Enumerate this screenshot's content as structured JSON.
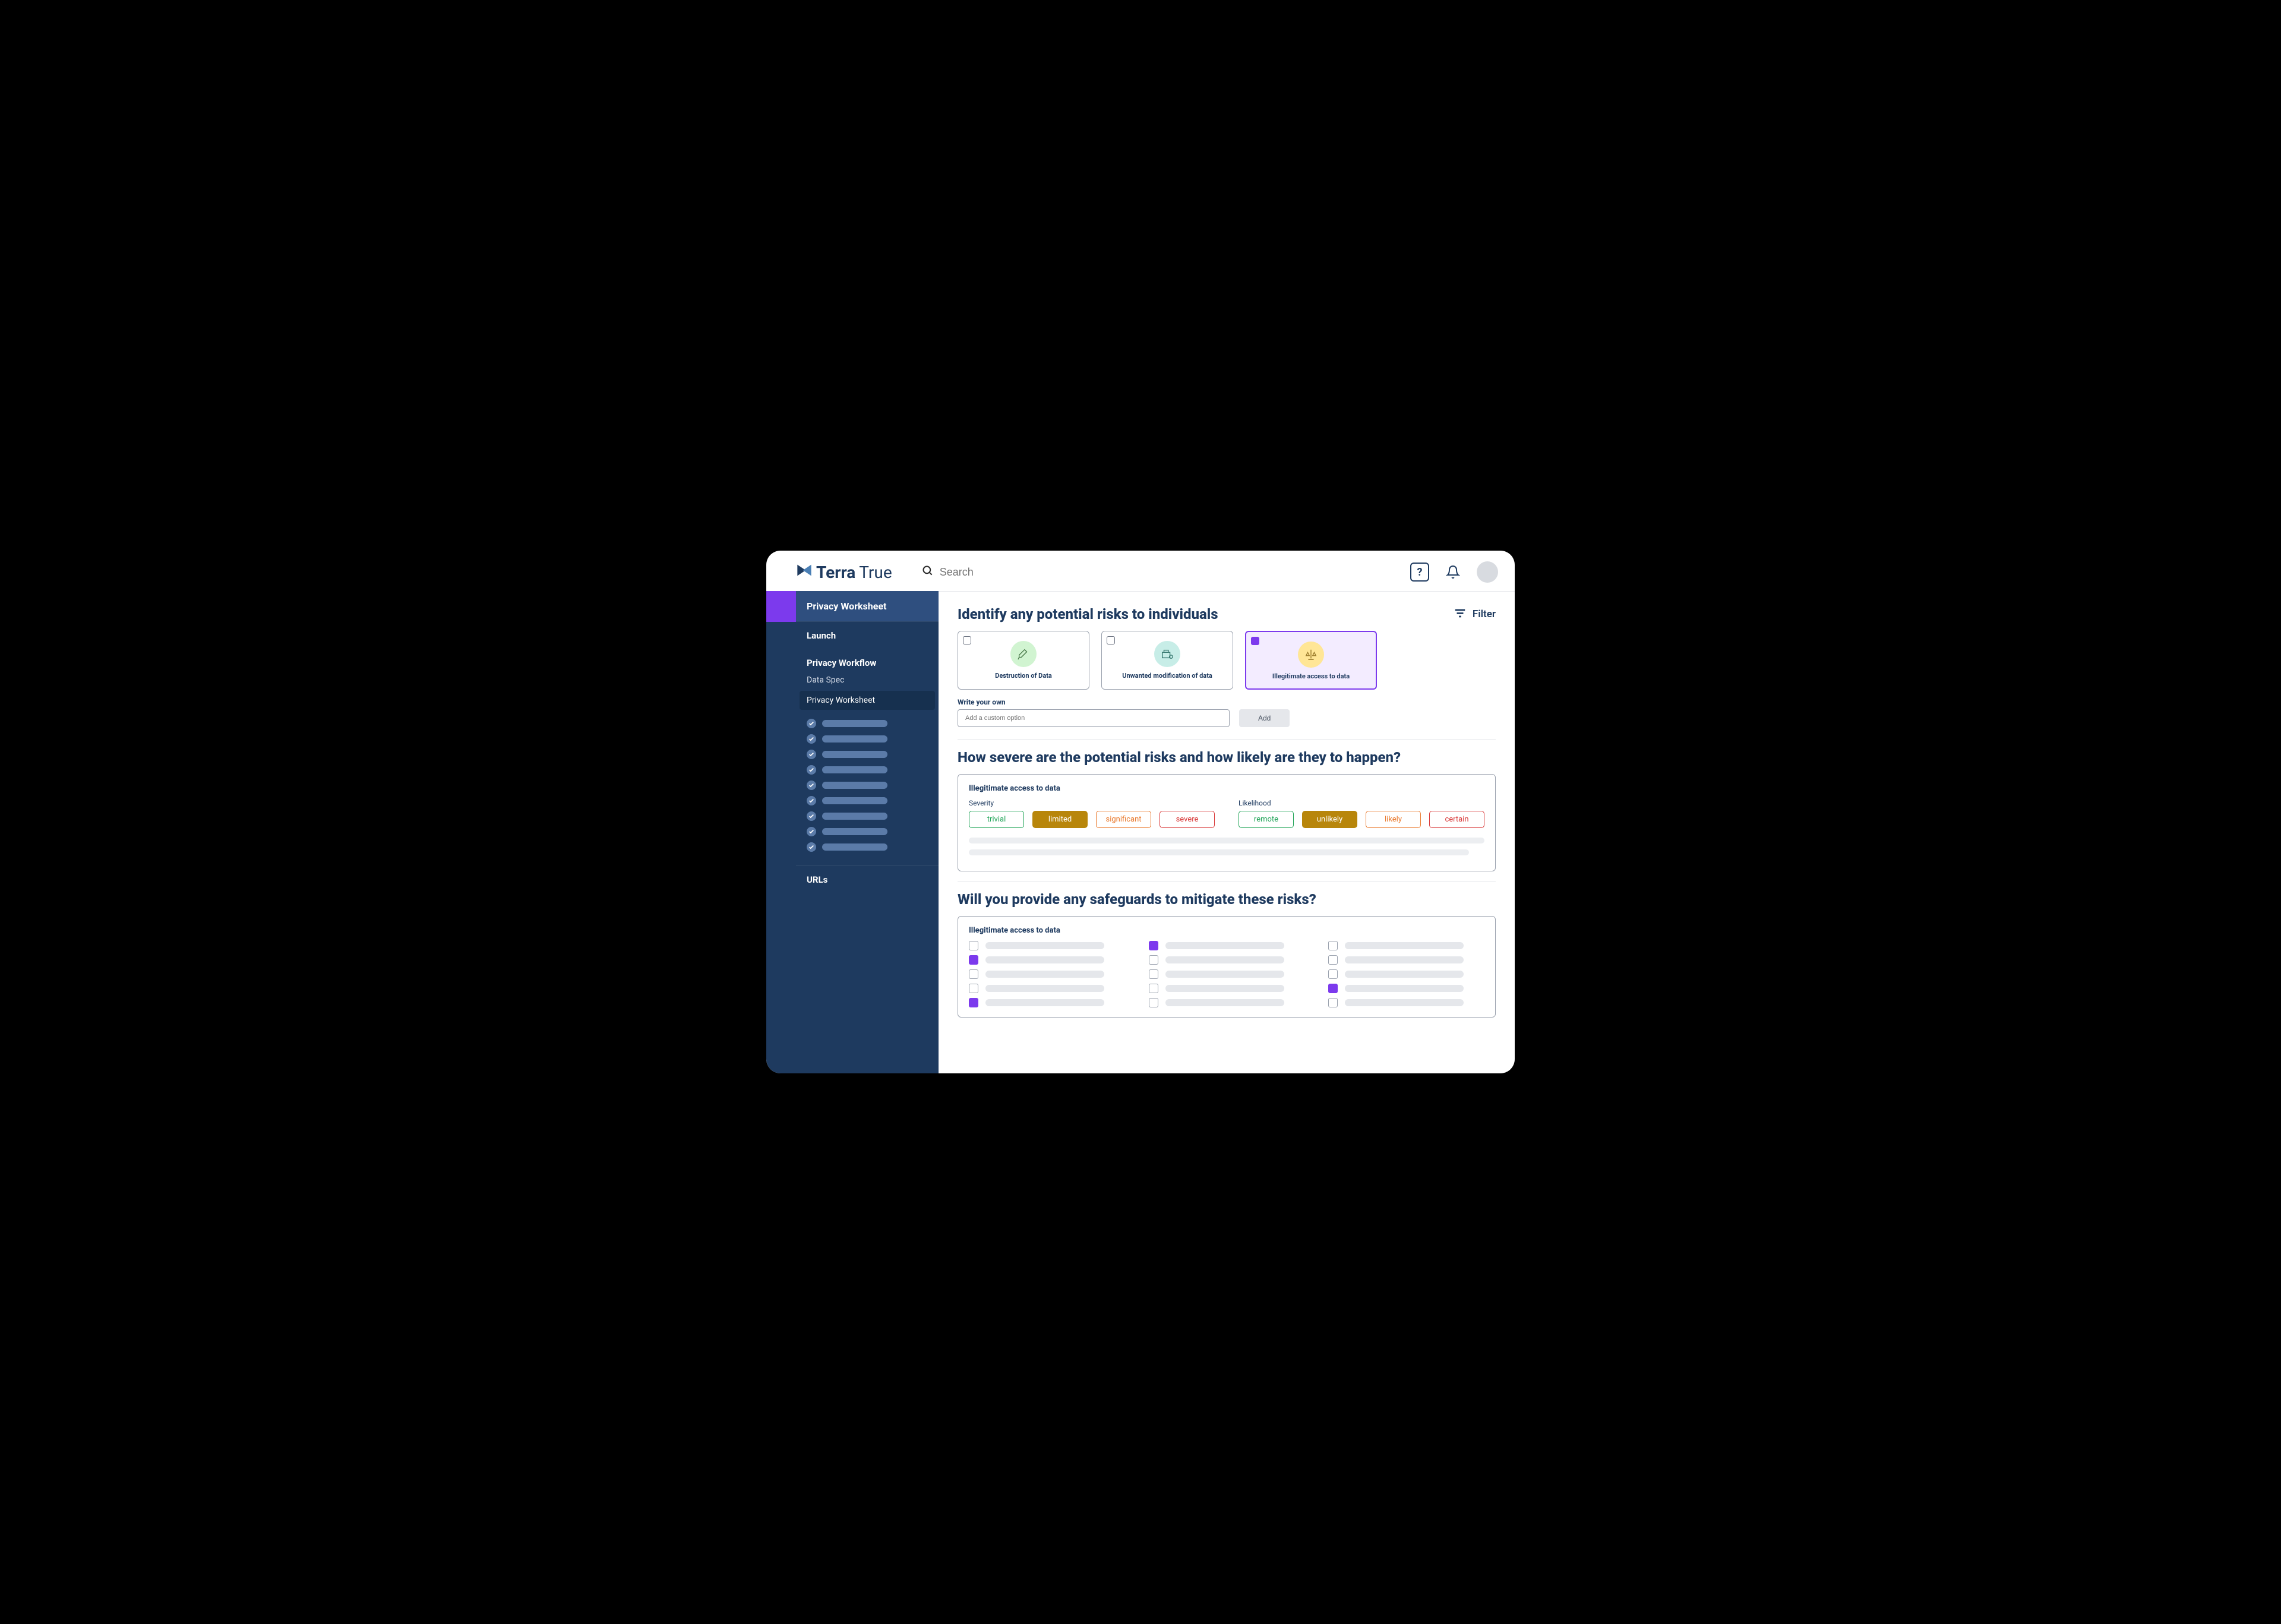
{
  "brand": {
    "name1": "Terra",
    "name2": "True"
  },
  "search": {
    "placeholder": "Search"
  },
  "filter_label": "Filter",
  "sidebar": {
    "page_label": "Privacy Worksheet",
    "launch": "Launch",
    "workflow_section": "Privacy Workflow",
    "items": [
      {
        "label": "Data Spec",
        "active": false
      },
      {
        "label": "Privacy Worksheet",
        "active": true
      }
    ],
    "check_count": 9,
    "urls": "URLs"
  },
  "section1": {
    "title": "Identify any potential risks to individuals",
    "cards": [
      {
        "label": "Destruction of Data",
        "bg": "bg-green",
        "selected": false
      },
      {
        "label": "Unwanted modification of data",
        "bg": "bg-teal",
        "selected": false
      },
      {
        "label": "Illegitimate access to data",
        "bg": "bg-yellow",
        "selected": true
      }
    ],
    "write_own": "Write your own",
    "custom_placeholder": "Add a custom option",
    "add_label": "Add"
  },
  "section2": {
    "title": "How severe are the potential risks and how likely are they to happen?",
    "panel_title": "Illegitimate access to data",
    "severity_label": "Severity",
    "likelihood_label": "Likelihood",
    "severity": [
      {
        "label": "trivial",
        "cls": "green",
        "selected": false
      },
      {
        "label": "limited",
        "cls": "amber",
        "selected": true
      },
      {
        "label": "significant",
        "cls": "orange",
        "selected": false
      },
      {
        "label": "severe",
        "cls": "red",
        "selected": false
      }
    ],
    "likelihood": [
      {
        "label": "remote",
        "cls": "green",
        "selected": false
      },
      {
        "label": "unlikely",
        "cls": "amber",
        "selected": true
      },
      {
        "label": "likely",
        "cls": "orange",
        "selected": false
      },
      {
        "label": "certain",
        "cls": "red",
        "selected": false
      }
    ]
  },
  "section3": {
    "title": "Will you provide any safeguards to mitigate these risks?",
    "panel_title": "Illegitimate access to data",
    "safeguards": [
      {
        "checked": false
      },
      {
        "checked": true
      },
      {
        "checked": false
      },
      {
        "checked": true
      },
      {
        "checked": false
      },
      {
        "checked": false
      },
      {
        "checked": false
      },
      {
        "checked": false
      },
      {
        "checked": false
      },
      {
        "checked": false
      },
      {
        "checked": false
      },
      {
        "checked": true
      },
      {
        "checked": true
      },
      {
        "checked": false
      },
      {
        "checked": false
      }
    ]
  }
}
